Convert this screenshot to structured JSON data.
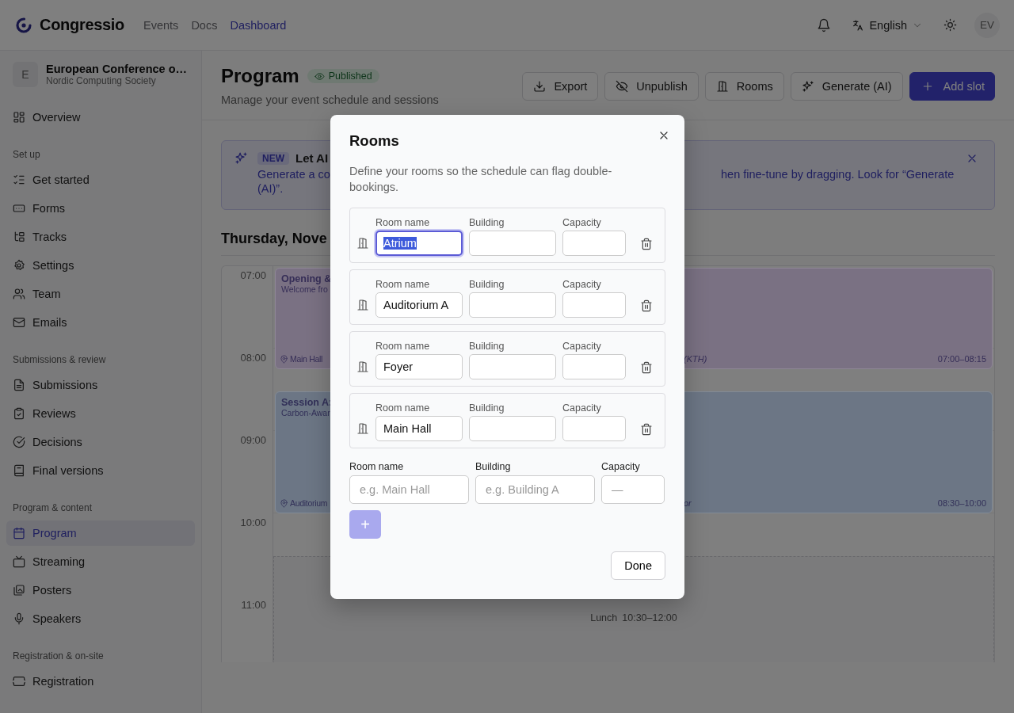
{
  "topbar": {
    "brand": "Congressio",
    "nav": [
      {
        "label": "Events",
        "selected": false
      },
      {
        "label": "Docs",
        "selected": false
      },
      {
        "label": "Dashboard",
        "selected": true
      }
    ],
    "language": "English",
    "avatar": "EV"
  },
  "sidebar": {
    "org": {
      "initial": "E",
      "name": "European Conference o…",
      "owner": "Nordic Computing Society"
    },
    "top_items": [
      {
        "label": "Overview",
        "selected": false
      }
    ],
    "sections": [
      {
        "heading": "Set up",
        "items": [
          {
            "label": "Get started",
            "selected": false
          },
          {
            "label": "Forms",
            "selected": false
          },
          {
            "label": "Tracks",
            "selected": false
          },
          {
            "label": "Settings",
            "selected": false
          },
          {
            "label": "Team",
            "selected": false
          },
          {
            "label": "Emails",
            "selected": false
          }
        ]
      },
      {
        "heading": "Submissions & review",
        "items": [
          {
            "label": "Submissions",
            "selected": false
          },
          {
            "label": "Reviews",
            "selected": false
          },
          {
            "label": "Decisions",
            "selected": false
          },
          {
            "label": "Final versions",
            "selected": false
          }
        ]
      },
      {
        "heading": "Program & content",
        "items": [
          {
            "label": "Program",
            "selected": true
          },
          {
            "label": "Streaming",
            "selected": false
          },
          {
            "label": "Posters",
            "selected": false
          },
          {
            "label": "Speakers",
            "selected": false
          }
        ]
      },
      {
        "heading": "Registration & on-site",
        "items": [
          {
            "label": "Registration",
            "selected": false
          }
        ]
      }
    ]
  },
  "header": {
    "title": "Program",
    "status": "Published",
    "subtitle": "Manage your event schedule and sessions",
    "actions": [
      {
        "label": "Export",
        "kind": "secondary"
      },
      {
        "label": "Unpublish",
        "kind": "secondary"
      },
      {
        "label": "Rooms",
        "kind": "secondary"
      },
      {
        "label": "Generate (AI)",
        "kind": "secondary"
      },
      {
        "label": "Add slot",
        "kind": "primary"
      }
    ]
  },
  "banner": {
    "badge": "NEW",
    "title": "Let AI",
    "line_1_start": "Generate a co",
    "line_1_end": "hen fine-tune by dragging. Look for “Generate",
    "line_2": "(AI)”."
  },
  "day": "Thursday, Nove",
  "schedule": {
    "hours": [
      "07:00",
      "08:00",
      "09:00",
      "10:00",
      "11:00"
    ],
    "events": [
      {
        "color": "#7a7183",
        "title": "Opening &",
        "subtitle": "Welcome fro",
        "location": "Main Hall",
        "speaker": "(KTH)",
        "time": "07:00–08:15"
      },
      {
        "color": "#6c7685",
        "title": "Session A:",
        "subtitle": "Carbon-Awar",
        "location": "Auditorium",
        "speaker": "or",
        "time": "08:30–10:00"
      }
    ],
    "break": {
      "label": "Lunch",
      "time": "10:30–12:00"
    }
  },
  "dialog": {
    "title": "Rooms",
    "description": "Define your rooms so the schedule can flag double-bookings.",
    "rooms": [
      {
        "labels": [
          "Room name",
          "Building",
          "Capacity"
        ],
        "name": "Atrium",
        "focused": true
      },
      {
        "labels": [
          "Room name",
          "Building",
          "Capacity"
        ],
        "name": "Auditorium A",
        "focused": false
      },
      {
        "labels": [
          "Room name",
          "Building",
          "Capacity"
        ],
        "name": "Foyer",
        "focused": false
      },
      {
        "labels": [
          "Room name",
          "Building",
          "Capacity"
        ],
        "name": "Main Hall",
        "focused": false
      }
    ],
    "new_room": {
      "labels": [
        "Room name",
        "Building",
        "Capacity"
      ],
      "placeholders": [
        "e.g. Main Hall",
        "e.g. Building A",
        "—"
      ]
    },
    "add": {
      "label": "+",
      "disabled": true
    },
    "done": "Done"
  }
}
